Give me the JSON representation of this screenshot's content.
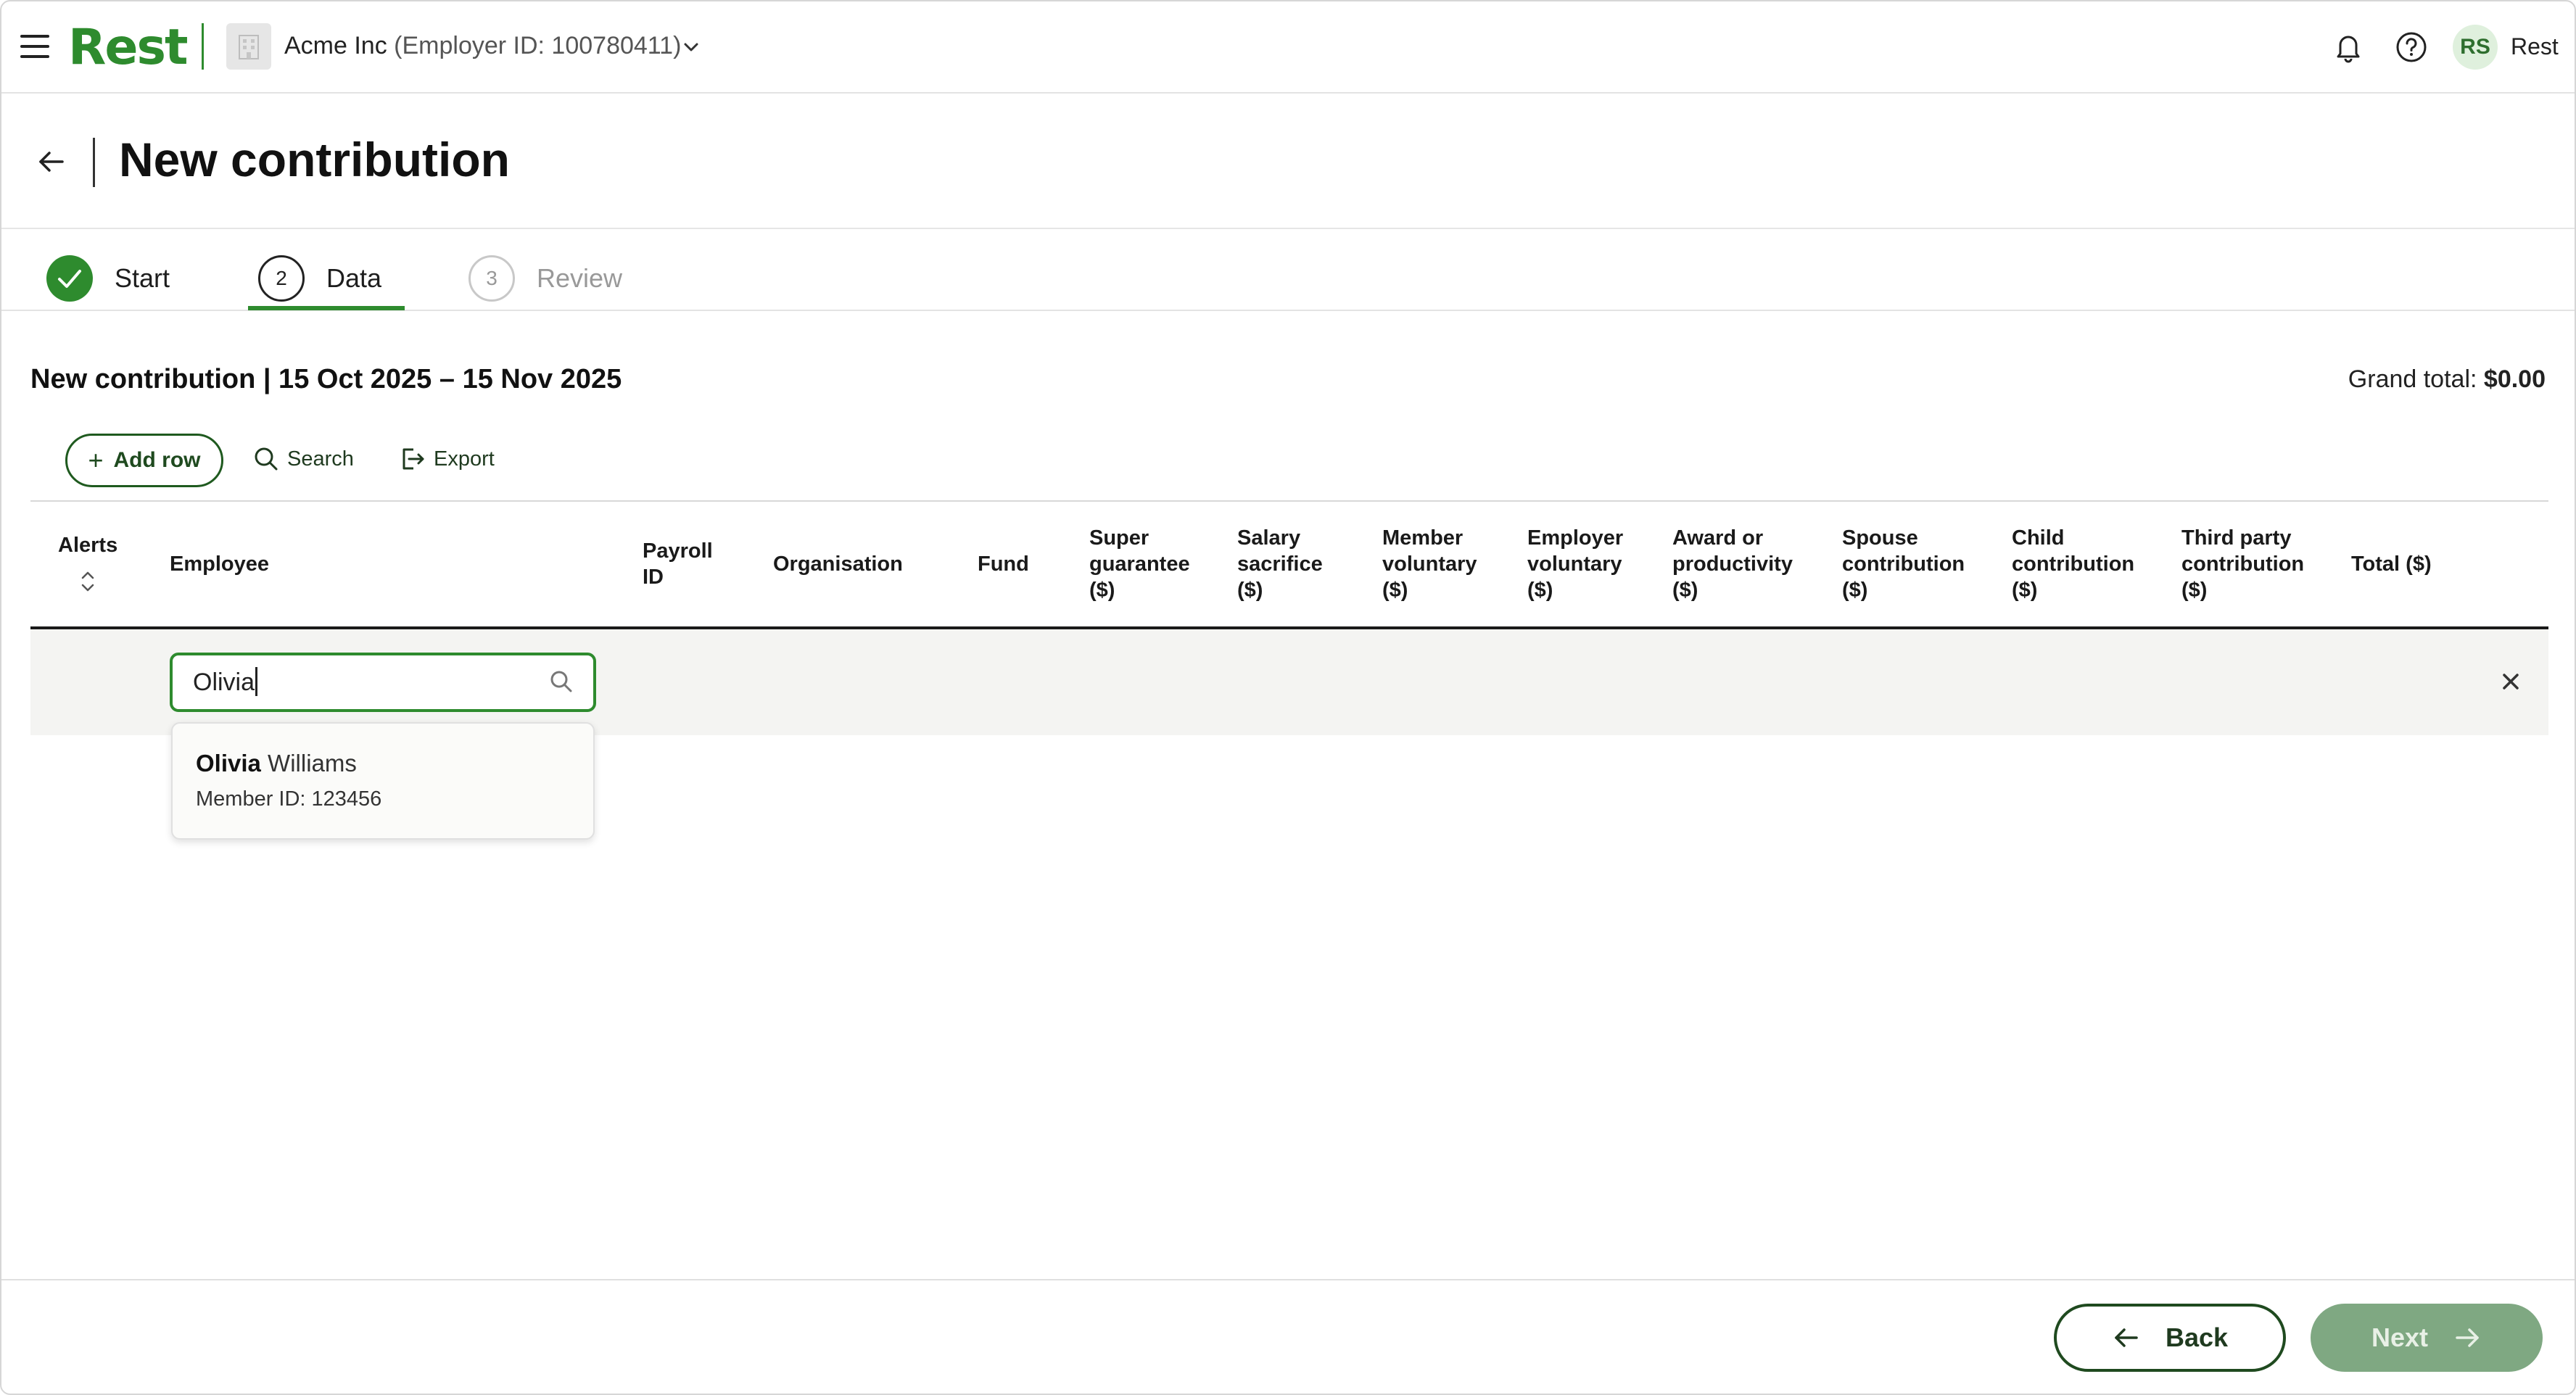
{
  "app": {
    "logo": "Rest",
    "org_name": "Acme Inc",
    "org_sub": "(Employer ID: 100780411)",
    "user_initials": "RS",
    "user_name": "Rest"
  },
  "page": {
    "title": "New contribution"
  },
  "stepper": {
    "steps": [
      {
        "number": "",
        "label": "Start",
        "state": "complete"
      },
      {
        "number": "2",
        "label": "Data",
        "state": "active"
      },
      {
        "number": "3",
        "label": "Review",
        "state": "upcoming"
      }
    ]
  },
  "contribution": {
    "title": "New contribution | 15 Oct 2025 – 15 Nov 2025",
    "grand_total_label": "Grand total:",
    "grand_total_value": "$0.00"
  },
  "toolbar": {
    "add_row": "Add row",
    "search": "Search",
    "export": "Export"
  },
  "table": {
    "columns": {
      "alerts": "Alerts",
      "employee": "Employee",
      "payroll_id": [
        "Payroll",
        "ID"
      ],
      "organisation": "Organisation",
      "fund": "Fund",
      "super_guarantee": [
        "Super",
        "guarantee",
        "($)"
      ],
      "salary_sacrifice": [
        "Salary",
        "sacrifice",
        "($)"
      ],
      "member_voluntary": [
        "Member",
        "voluntary",
        "($)"
      ],
      "employer_voluntary": [
        "Employer",
        "voluntary",
        "($)"
      ],
      "award_productivity": [
        "Award or",
        "productivity",
        "($)"
      ],
      "spouse_contribution": [
        "Spouse",
        "contribution",
        "($)"
      ],
      "child_contribution": [
        "Child",
        "contribution",
        "($)"
      ],
      "third_party": [
        "Third party",
        "contribution",
        "($)"
      ],
      "total": "Total ($)"
    },
    "row": {
      "employee_query": "Olivia"
    }
  },
  "autocomplete": {
    "match": "Olivia",
    "rest": " Williams",
    "member_id": "Member ID: 123456"
  },
  "footer": {
    "back": "Back",
    "next": "Next"
  },
  "colors": {
    "brand_green": "#2e8b2e",
    "dark_green": "#1f4a1f",
    "disabled_next": "#7fa882"
  }
}
